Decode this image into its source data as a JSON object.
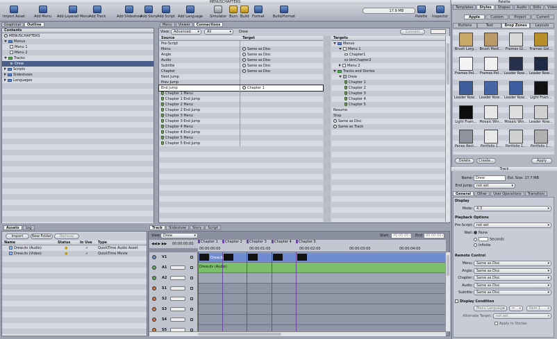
{
  "window": {
    "title": "MENUSCHAPTERS"
  },
  "toolbar": {
    "buttons": [
      {
        "label": "Import Asset",
        "icon": "import-icon"
      },
      {
        "label": "Add Menu",
        "icon": "menu-icon"
      },
      {
        "label": "Add Layered Menu",
        "icon": "layered-menu-icon"
      },
      {
        "label": "Add Track",
        "icon": "track-icon"
      },
      {
        "label": "Add Slideshow",
        "icon": "slideshow-icon"
      },
      {
        "label": "Add Story",
        "icon": "story-icon"
      },
      {
        "label": "Add Script",
        "icon": "script-icon"
      },
      {
        "label": "Add Language",
        "icon": "language-icon"
      },
      {
        "label": "Simulator",
        "icon": "simulator-icon"
      },
      {
        "label": "Burn",
        "icon": "burn-icon"
      },
      {
        "label": "Build",
        "icon": "build-icon"
      },
      {
        "label": "Format",
        "icon": "format-icon"
      },
      {
        "label": "Build/Format",
        "icon": "build-format-icon"
      },
      {
        "label": "Palette",
        "icon": "palette-icon"
      },
      {
        "label": "Inspector",
        "icon": "inspector-icon"
      }
    ],
    "memory": "17.9 MB"
  },
  "outline": {
    "tabs": [
      "Graphical",
      "Outline"
    ],
    "header": "Contents",
    "items": [
      {
        "label": "MENUSCHAPTERS",
        "level": 0,
        "type": "disc"
      },
      {
        "label": "Menus",
        "level": 0,
        "type": "folder",
        "open": true
      },
      {
        "label": "Menu 1",
        "level": 1,
        "type": "menu"
      },
      {
        "label": "Menu 2",
        "level": 1,
        "type": "menu"
      },
      {
        "label": "Tracks",
        "level": 0,
        "type": "folder-green",
        "open": true
      },
      {
        "label": "Drew",
        "level": 1,
        "type": "track",
        "selected": true
      },
      {
        "label": "Scripts",
        "level": 0,
        "type": "folder",
        "open": false
      },
      {
        "label": "Slideshows",
        "level": 0,
        "type": "folder",
        "open": false
      },
      {
        "label": "Languages",
        "level": 0,
        "type": "folder",
        "open": false
      }
    ]
  },
  "connections": {
    "tabs": [
      "Menu",
      "Viewer",
      "Connections"
    ],
    "view_label": "View:",
    "view_value": "Advanced",
    "filter_value": "All",
    "context": "Drew",
    "connect_label": "Connect",
    "col_source": "Source",
    "col_target": "Target",
    "rows": [
      {
        "source": "Pre-Script",
        "target": "",
        "shield": false
      },
      {
        "source": "Menu",
        "target": "Same as Disc",
        "shield": false
      },
      {
        "source": "Angle",
        "target": "Same as Disc",
        "shield": false
      },
      {
        "source": "Audio",
        "target": "Same as Disc",
        "shield": false
      },
      {
        "source": "Subtitle",
        "target": "Same as Disc",
        "shield": false
      },
      {
        "source": "Chapter",
        "target": "Same as Disc",
        "shield": false
      },
      {
        "source": "Next Jump",
        "target": "",
        "shield": false
      },
      {
        "source": "Prev Jump",
        "target": "",
        "shield": false
      },
      {
        "source": "End Jump",
        "target": "Chapter 1",
        "shield": false,
        "selected": true
      },
      {
        "source": "Chapter 1 Menu",
        "target": "",
        "shield": true
      },
      {
        "source": "Chapter 1 End Jump",
        "target": "",
        "shield": true
      },
      {
        "source": "Chapter 2 Menu",
        "target": "",
        "shield": true
      },
      {
        "source": "Chapter 2 End Jump",
        "target": "",
        "shield": true
      },
      {
        "source": "Chapter 3 Menu",
        "target": "",
        "shield": true
      },
      {
        "source": "Chapter 3 End Jump",
        "target": "",
        "shield": true
      },
      {
        "source": "Chapter 4 Menu",
        "target": "",
        "shield": true
      },
      {
        "source": "Chapter 4 End Jump",
        "target": "",
        "shield": true
      },
      {
        "source": "Chapter 5 Menu",
        "target": "",
        "shield": true
      },
      {
        "source": "Chapter 5 End Jump",
        "target": "",
        "shield": true
      }
    ]
  },
  "targets": {
    "header": "Targets",
    "items": [
      {
        "label": "Menus",
        "level": 0,
        "type": "folder",
        "open": true
      },
      {
        "label": "Menu 1",
        "level": 1,
        "type": "menu",
        "open": true
      },
      {
        "label": "Chapter1",
        "level": 2,
        "type": "button"
      },
      {
        "label": "btnChapter2",
        "level": 2,
        "type": "button"
      },
      {
        "label": "Menu 2",
        "level": 1,
        "type": "menu",
        "open": false
      },
      {
        "label": "Tracks and Stories",
        "level": 0,
        "type": "folder-green",
        "open": true
      },
      {
        "label": "Drew",
        "level": 1,
        "type": "track",
        "open": true
      },
      {
        "label": "Chapter 1",
        "level": 2,
        "type": "chapter"
      },
      {
        "label": "Chapter 2",
        "level": 2,
        "type": "chapter"
      },
      {
        "label": "Chapter 3",
        "level": 2,
        "type": "chapter"
      },
      {
        "label": "Chapter 4",
        "level": 2,
        "type": "chapter"
      },
      {
        "label": "Chapter 5",
        "level": 2,
        "type": "chapter"
      },
      {
        "label": "Resume",
        "level": 0,
        "type": "plain"
      },
      {
        "label": "Stop",
        "level": 0,
        "type": "plain"
      },
      {
        "label": "Same as Disc",
        "level": 0,
        "type": "circle"
      },
      {
        "label": "Same as Track",
        "level": 0,
        "type": "circle"
      }
    ]
  },
  "assets": {
    "tabs": [
      "Assets",
      "Log"
    ],
    "import_label": "Import",
    "new_folder_label": "New Folder",
    "remove_label": "Remove",
    "columns": [
      "Name",
      "Status",
      "In Use",
      "Type"
    ],
    "rows": [
      {
        "name": "Drew.dv (Audio)",
        "status": "●",
        "in_use": "✓",
        "type": "QuickTime Audio Asset"
      },
      {
        "name": "Drew.dv (Video)",
        "status": "●",
        "in_use": "✓",
        "type": "QuickTime Movie"
      }
    ]
  },
  "timeline": {
    "tabs": [
      "Track",
      "Slideshow",
      "Story",
      "Script"
    ],
    "view_label": "View:",
    "view_value": "Drew",
    "start_label": "Start:",
    "start_value": "00:00:00:00",
    "end_label": "End:",
    "end_value": "00:00:00:00",
    "timecode": "00:00:00:00",
    "ruler": [
      "00:00:00:00",
      "00:00:01:00",
      "00:00:02:00",
      "00:00:03:00",
      "00:00:04:00"
    ],
    "chapters": [
      "Chapter 1",
      "Chapter 2",
      "Chapter 3",
      "Chapter 4",
      "Chapter 5"
    ],
    "tracks": [
      {
        "label": "V1",
        "kind": "video",
        "clip": "Drew.dv"
      },
      {
        "label": "A1",
        "kind": "audio",
        "clip": "Drew.dv (Audio)"
      },
      {
        "label": "A2",
        "kind": "audio",
        "clip": ""
      },
      {
        "label": "S1",
        "kind": "sub",
        "clip": ""
      },
      {
        "label": "S2",
        "kind": "sub",
        "clip": ""
      },
      {
        "label": "S3",
        "kind": "sub",
        "clip": ""
      },
      {
        "label": "S4",
        "kind": "sub",
        "clip": ""
      },
      {
        "label": "S5",
        "kind": "sub",
        "clip": ""
      }
    ]
  },
  "palette": {
    "title": "Palette",
    "tabs": [
      "Templates",
      "Styles",
      "Shapes",
      "Audio",
      "Stills",
      "Video"
    ],
    "subtabs": [
      "Apple",
      "Custom",
      "Project",
      "Current"
    ],
    "categories": [
      "Buttons",
      "Text",
      "Drop Zones",
      "Layouts"
    ],
    "thumbs": [
      {
        "label": "Brush Larg…",
        "color": "#c9a86a"
      },
      {
        "label": "Brush Medi…",
        "color": "#b99966"
      },
      {
        "label": "Frames Gl…",
        "color": "#d8d8da"
      },
      {
        "label": "Frames Gol…",
        "color": "#b88e2a"
      },
      {
        "label": "Frames Pol…",
        "color": "#f4f4f4"
      },
      {
        "label": "Frames Pol…",
        "color": "#f0f0f0"
      },
      {
        "label": "Leader Row…",
        "color": "#27304a"
      },
      {
        "label": "Leader Row…",
        "color": "#1f2a44"
      },
      {
        "label": "Leader Row…",
        "color": "#3c5c9a"
      },
      {
        "label": "Leader Row…",
        "color": "#4565a5"
      },
      {
        "label": "Leader Row…",
        "color": "#3b5c9e"
      },
      {
        "label": "Light Fram…",
        "color": "#111111"
      },
      {
        "label": "Light Fram…",
        "color": "#0c0c0c"
      },
      {
        "label": "Mosaic Win…",
        "color": "#e6e6e6"
      },
      {
        "label": "Mosaic Win…",
        "color": "#dedede"
      },
      {
        "label": "Leader Row…",
        "color": "#cfcfcf"
      },
      {
        "label": "Panes Rect…",
        "color": "#8e939e"
      },
      {
        "label": "Portfolio 1…",
        "color": "#e8e8e8"
      },
      {
        "label": "Portfolio 1…",
        "color": "#d0d0d0"
      },
      {
        "label": "Portfolio 1…",
        "color": "#b0b0b0"
      }
    ],
    "delete_label": "Delete",
    "create_label": "Create...",
    "apply_label": "Apply"
  },
  "inspector": {
    "title": "Track",
    "name_label": "Name:",
    "name_value": "Drew",
    "est_size": "Est. Size: 17.7 MB",
    "end_jump_label": "End Jump:",
    "end_jump_value": "not set",
    "tabs": [
      "General",
      "Other",
      "User Operations",
      "Transition"
    ],
    "display_section": "Display",
    "mode_label": "Mode:",
    "mode_value": "4:3",
    "playback_section": "Playback Options",
    "prescript_label": "Pre-Script:",
    "prescript_value": "not set",
    "wait_label": "Wait:",
    "wait_none": "None",
    "wait_seconds": "Seconds",
    "wait_infinite": "Infinite",
    "remote_section": "Remote Control",
    "remote_rows": [
      {
        "label": "Menu:",
        "value": "Same as Disc"
      },
      {
        "label": "Angle:",
        "value": "Same as Disc"
      },
      {
        "label": "Chapter:",
        "value": "Same as Disc"
      },
      {
        "label": "Audio:",
        "value": "Same as Disc"
      },
      {
        "label": "Subtitle:",
        "value": "Same as Disc"
      }
    ],
    "display_condition": "Display Condition",
    "condition_menu": "Menu Language",
    "condition_op": "=",
    "condition_item": "Item 1",
    "alt_target_label": "Alternate Target:",
    "alt_target_value": "not set",
    "apply_stories": "Apply to Stories"
  }
}
